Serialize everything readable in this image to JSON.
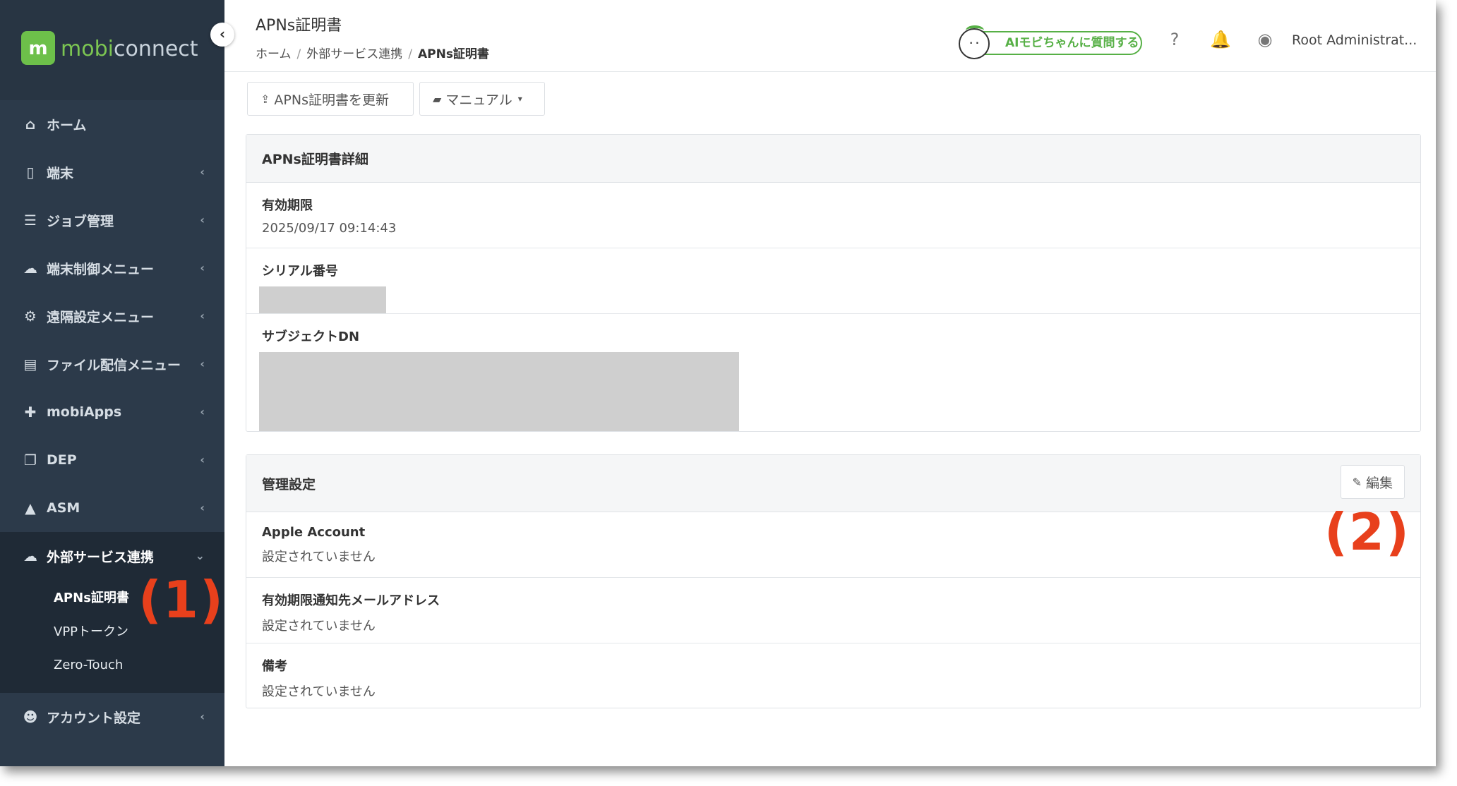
{
  "brand": {
    "logo_mark": "m",
    "name_part1": "mobi",
    "name_part2": "connect"
  },
  "header": {
    "page_title": "APNs証明書",
    "breadcrumb": [
      "ホーム",
      "外部サービス連携",
      "APNs証明書"
    ],
    "ai_button_label": "AIモビちゃんに質問する",
    "user_name": "Root Administrat..."
  },
  "sidebar": {
    "items": [
      {
        "label": "ホーム",
        "icon": "home-icon"
      },
      {
        "label": "端末",
        "icon": "tablet-icon"
      },
      {
        "label": "ジョブ管理",
        "icon": "server-icon"
      },
      {
        "label": "端末制御メニュー",
        "icon": "cloud-signal-icon"
      },
      {
        "label": "遠隔設定メニュー",
        "icon": "cogs-icon"
      },
      {
        "label": "ファイル配信メニュー",
        "icon": "file-icon"
      },
      {
        "label": "mobiApps",
        "icon": "puzzle-icon"
      },
      {
        "label": "DEP",
        "icon": "copy-icon"
      },
      {
        "label": "ASM",
        "icon": "graduation-cap-icon"
      }
    ],
    "expanded_group": {
      "label": "外部サービス連携",
      "icon": "cloud-icon",
      "sub_items": [
        "APNs証明書",
        "VPPトークン",
        "Zero-Touch"
      ]
    },
    "footer_item": {
      "label": "アカウント設定",
      "icon": "users-icon"
    }
  },
  "toolbar": {
    "update_label": "APNs証明書を更新",
    "manual_label": "マニュアル"
  },
  "cert_panel": {
    "title": "APNs証明書詳細",
    "expiry_label": "有効期限",
    "expiry_value": "2025/09/17 09:14:43",
    "serial_label": "シリアル番号",
    "subject_label": "サブジェクトDN"
  },
  "settings_panel": {
    "title": "管理設定",
    "edit_label": "編集",
    "apple_account_label": "Apple Account",
    "apple_account_value": "設定されていません",
    "email_label": "有効期限通知先メールアドレス",
    "email_value": "設定されていません",
    "notes_label": "備考",
    "notes_value": "設定されていません"
  },
  "annotations": {
    "one": "(1)",
    "two": "(2)"
  },
  "colors": {
    "sidebar_bg": "#2c3a4a",
    "brand_green": "#6dc04a",
    "annotation_red": "#e8401c"
  }
}
